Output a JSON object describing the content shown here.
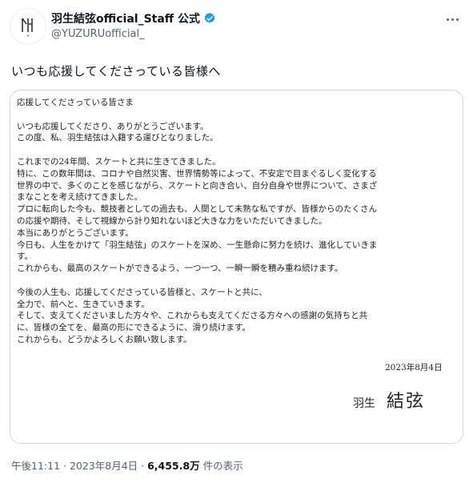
{
  "tweet": {
    "display_name": "羽生結弦official_Staff 公式",
    "handle": "@YUZURUofficial_",
    "text": "いつも応援してくださっている皆様へ",
    "timestamp": "午後11:11 · 2023年8月4日",
    "separator": " · ",
    "views_count": "6,455.8万",
    "views_label": " 件の表示"
  },
  "icons": {
    "avatar": "logo-avatar",
    "verified": "verified-badge-icon",
    "more": "more-icon"
  },
  "colors": {
    "verified": "#1d9bf0",
    "text": "#0f1419",
    "secondary": "#536471",
    "border": "#cfd9de"
  },
  "letter": {
    "lines": [
      "応援してくださっている皆さま",
      "",
      "いつも応援してくださり、ありがとうございます。",
      "この度、私、羽生結弦は入籍する運びとなりました。",
      "",
      "これまでの24年間、スケートと共に生きてきました。",
      "特に、この数年間は、コロナや自然災害、世界情勢等によって、不安定で目まぐるしく変化する",
      "世界の中で、多くのことを感じながら、スケートと向き合い、自分自身や世界について、さまざ",
      "まなことを考え続けてきました。",
      "プロに転向した今も、競技者としての過去も、人間として未熟な私ですが、皆様からのたくさん",
      "の応援や期待、そして視線から計り知れないほど大きな力をいただいてきました。",
      "本当にありがとうございます。",
      "今日も、人生をかけて「羽生結弦」のスケートを深め、一生懸命に努力を続け、進化していきま",
      "す。",
      "これからも、最高のスケートができるよう、一つ一つ、一瞬一瞬を積み重ね続けます。",
      "",
      "今後の人生も、応援してくださっている皆様と、スケートと共に、",
      "全力で、前へと、生きていきます。",
      "そして、支えてくださいました方々や、これからも支えてくださる方々への感謝の気持ちと共",
      "に、皆様の全てを、最高の形にできるように、滑り続けます。",
      "これからも、どうかよろしくお願い致します。"
    ],
    "date": "2023年8月4日",
    "signature_a": "羽生",
    "signature_b": "結弦"
  }
}
